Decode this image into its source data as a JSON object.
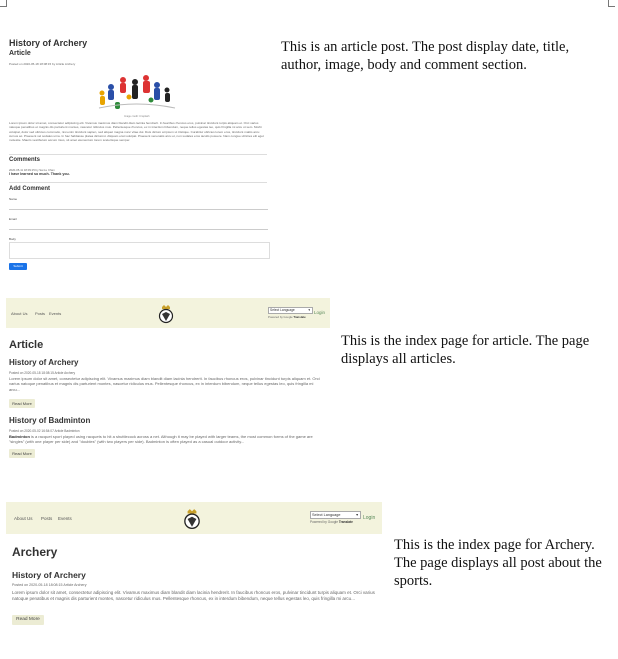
{
  "section_post": {
    "title": "History of Archery",
    "subtitle": "Article",
    "meta": "Posted on 2020-05-18 18:08:15 by Article Archery",
    "image_caption": "Image credit: Unsplash",
    "body": "Lorem ipsum dolor sit amet, consectetur adipiscing elit. Vivamus maximus diam blandit diam lacinia hendrerit. In faucibus rhoncus eros, pulvinar tincidunt turpis aliquam et. Orci varius natoque penatibus et magnis dis parturient montes, nascetur ridiculus mus. Pellentesque rhoncus, ex in interdum bibendum, neque tellus egestas leo, quis fringilla mi arcu ut sem. Morbi volutpat, dolor sed ultricies commodo, nisi enim tincidunt sapien, sed aliquet magna nunc vitae dui. Duis dictum at ipsum ut tristique. Curabitur ultricies lorem eros, tincidunt mattis arcu cursus ac. Praesent vel sodales urna. In hac habitasse platea dictumst. Aliquam erat volutpat. Praesent venenatis arcu et, non sodales eros iaculis posuere. Nam congue ultricies elit eget molestie. Mauris vestibulum accum risus, sit amet elementum lorem scelerisque semper.",
    "comments_heading": "Comments",
    "comment_meta": "2020-05-11 18:09:15 by Sai Lu Chan",
    "comment_text": "I have learned so much. Thank you.",
    "add_comment_heading": "Add Comment",
    "label_name": "Name",
    "label_email": "Email",
    "label_body": "Body",
    "submit_label": "Submit"
  },
  "nav": {
    "about": "About Us",
    "posts": "Posts",
    "events": "Events",
    "language_select": "Select Language",
    "powered_by": "Powered by Google",
    "translate": "Translate",
    "login": "Login"
  },
  "section_index": {
    "heading": "Article",
    "posts": [
      {
        "title": "History of Archery",
        "meta": "Posted on 2020-05-18 18:08:15 Article Archery",
        "text_bold": "",
        "text": "Lorem ipsum dolor sit amet, consectetur adipiscing elit. Vivamus maximus diam blandit diam lacinia hendrerit. In faucibus rhoncus eros, pulvinar tincidunt turpis aliquam et. Orci varius natoque penatibus et magnis dis parturient montes, nascetur ridiculus mus. Pellentesque rhoncus, ex in interdum bibendum, neque tellus egestas leo, quis fringilla mi arcu...",
        "read_more": "Read More"
      },
      {
        "title": "History of Badminton",
        "meta": "Posted on 2020-05-02 16:54:07 Article Badminton",
        "text_bold": "Badminton",
        "text": " is a racquet sport played using racquets to hit a shuttlecock across a net. Although it may be played with larger teams, the most common forms of the game are \"singles\" (with one player per side) and \"doubles\" (with two players per side). Badminton is often played as a casual outdoor activity...",
        "read_more": "Read More"
      }
    ]
  },
  "section_sport": {
    "heading": "Archery",
    "post_title": "History of Archery",
    "meta": "Posted on 2020-05-18 18:08:15 Article Archery",
    "text": "Lorem ipsum dolor sit amet, consectetur adipiscing elit. Vivamus maximus diam blandit diam lacinia hendrerit. In faucibus rhoncus eros, pulvinar tincidunt turpis aliquam et. Orci varius natoque penatibus et magnis dis parturient montes, nascetur ridiculus mus. Pellentesque rhoncus, ex in interdum bibendum, neque tellus egestas leo, quis fringilla mi arcu...",
    "read_more": "Read More"
  },
  "captions": {
    "post": "This is an article post. The post display date, title, author, image, body and comment section.",
    "index": "This is the index page for article. The page displays all articles.",
    "sport": "This is the index page for Archery. The page displays all post about the sports."
  },
  "colors": {
    "navbar": "#f3f3dd",
    "button": "#ececd4",
    "submit": "#1a73e8"
  }
}
